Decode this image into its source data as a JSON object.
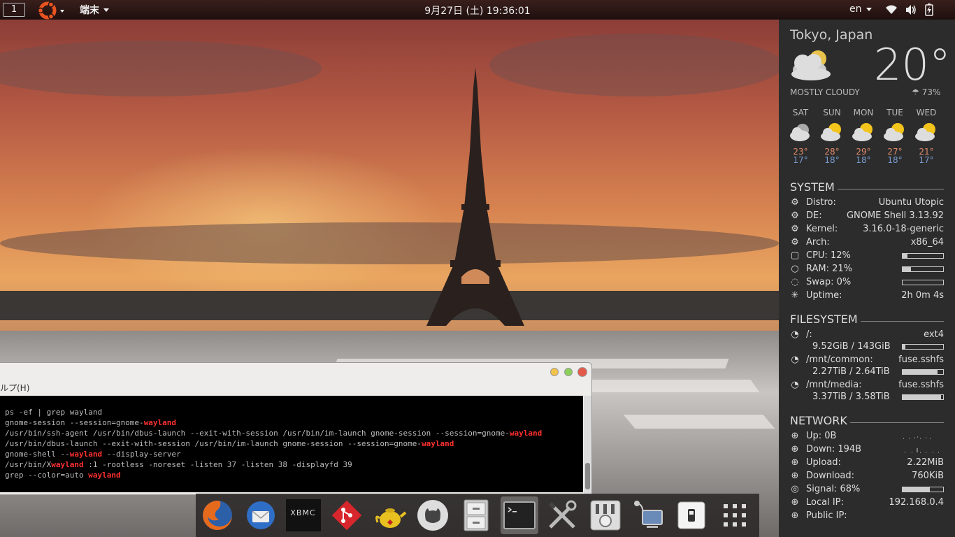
{
  "topbar": {
    "workspace": "1",
    "app_menu": "端末",
    "clock": "9月27日 (土) 19:36:01",
    "language": "en"
  },
  "terminal": {
    "menu_partial": "ルプ(H)",
    "lines": [
      [
        {
          "t": "ps -ef | grep wayland"
        }
      ],
      [
        {
          "t": "gnome-session --session=gnome-"
        },
        {
          "t": "wayland",
          "h": true
        }
      ],
      [
        {
          "t": "/usr/bin/ssh-agent /usr/bin/dbus-launch --exit-with-session /usr/bin/im-launch gnome-session --session=gnome-"
        },
        {
          "t": "wayland",
          "h": true
        }
      ],
      [
        {
          "t": "/usr/bin/dbus-launch --exit-with-session /usr/bin/im-launch gnome-session --session=gnome-"
        },
        {
          "t": "wayland",
          "h": true
        }
      ],
      [
        {
          "t": "gnome-shell --"
        },
        {
          "t": "wayland",
          "h": true
        },
        {
          "t": " --display-server"
        }
      ],
      [
        {
          "t": "/usr/bin/X"
        },
        {
          "t": "wayland",
          "h": true
        },
        {
          "t": " :1 -rootless -noreset -listen 37 -listen 38 -displayfd 39"
        }
      ],
      [
        {
          "t": "grep --color=auto "
        },
        {
          "t": "wayland",
          "h": true
        }
      ]
    ]
  },
  "dock": {
    "xbmc_label": "XBMC"
  },
  "weather": {
    "city": "Tokyo, Japan",
    "temp": "20°",
    "condition": "MOSTLY CLOUDY",
    "humidity": "73%",
    "forecast": [
      {
        "day": "SAT",
        "hi": "23°",
        "lo": "17°"
      },
      {
        "day": "SUN",
        "hi": "28°",
        "lo": "18°"
      },
      {
        "day": "MON",
        "hi": "29°",
        "lo": "18°"
      },
      {
        "day": "TUE",
        "hi": "27°",
        "lo": "18°"
      },
      {
        "day": "WED",
        "hi": "21°",
        "lo": "17°"
      }
    ]
  },
  "system": {
    "title": "SYSTEM",
    "distro_label": "Distro:",
    "distro": "Ubuntu Utopic",
    "de_label": "DE:",
    "de": "GNOME Shell 3.13.92",
    "kernel_label": "Kernel:",
    "kernel": "3.16.0-18-generic",
    "arch_label": "Arch:",
    "arch": "x86_64",
    "cpu_label": "CPU: 12%",
    "cpu_fraction": 0.12,
    "ram_label": "RAM: 21%",
    "ram_fraction": 0.21,
    "swap_label": "Swap: 0%",
    "swap_fraction": 0.0,
    "uptime_label": "Uptime:",
    "uptime": "2h 0m 4s"
  },
  "filesystem": {
    "title": "FILESYSTEM",
    "mounts": [
      {
        "path": "/:",
        "type": "ext4",
        "usage": "9.52GiB / 143GiB",
        "fraction": 0.07
      },
      {
        "path": "/mnt/common:",
        "type": "fuse.sshfs",
        "usage": "2.27TiB / 2.64TiB",
        "fraction": 0.86
      },
      {
        "path": "/mnt/media:",
        "type": "fuse.sshfs",
        "usage": "3.37TiB / 3.58TiB",
        "fraction": 0.94
      }
    ]
  },
  "network": {
    "title": "NETWORK",
    "up_label": "Up: 0B",
    "down_label": "Down: 194B",
    "upload_label": "Upload:",
    "upload": "2.22MiB",
    "download_label": "Download:",
    "download": "760KiB",
    "signal_label": "Signal: 68%",
    "signal_fraction": 0.68,
    "local_ip_label": "Local IP:",
    "local_ip": "192.168.0.4",
    "public_ip_label": "Public IP:"
  },
  "colors": {
    "panel": "#1d0f0e",
    "accent_red": "#ff3030",
    "temp_high": "#e08a6a",
    "temp_low": "#7a9cd0",
    "sidebar_bg": "#2c2c2c"
  }
}
